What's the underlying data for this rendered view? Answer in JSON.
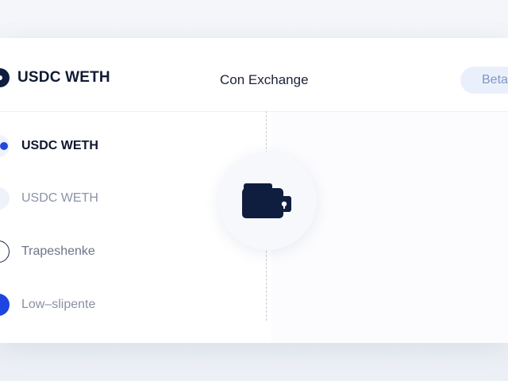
{
  "header": {
    "brand_title": "USDC WETH",
    "center_title": "Con Exchange",
    "badge": "Beta"
  },
  "list": {
    "items": [
      {
        "label": "USDC WETH",
        "state": "active"
      },
      {
        "label": "USDC WETH",
        "state": "muted"
      },
      {
        "label": "Trapeshenke",
        "state": "outline"
      },
      {
        "label": "Low–slipente",
        "state": "filled"
      }
    ]
  },
  "center": {
    "icon": "wallet-icon"
  },
  "colors": {
    "accent": "#1f45e0",
    "navy": "#0f1d3f",
    "muted_text": "#8b93a7",
    "badge_bg": "#eaf0fb"
  }
}
